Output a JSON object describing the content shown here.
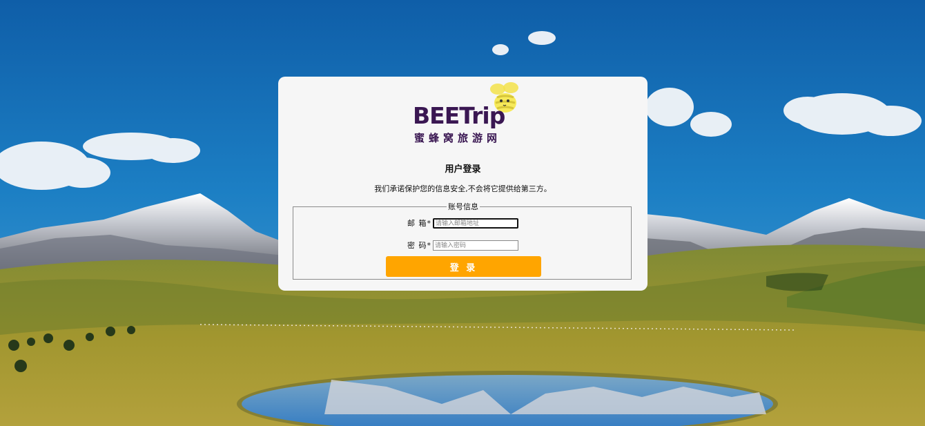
{
  "brand": {
    "name": "BEETrip",
    "tagline": "蜜蜂窝旅游网"
  },
  "login": {
    "title": "用户登录",
    "subtitle": "我们承诺保护您的信息安全,不会将它提供给第三方。",
    "fieldset_legend": "账号信息",
    "email": {
      "label": "邮 箱*",
      "placeholder": "请输入邮箱地址",
      "value": ""
    },
    "password": {
      "label": "密 码*",
      "placeholder": "请输入密码",
      "value": ""
    },
    "submit_label": "登 录"
  },
  "colors": {
    "accent": "#ffa500",
    "brand_purple": "#3a1752",
    "bee_yellow": "#f3e24a",
    "card_bg": "#f6f6f6",
    "sky": "#1a73b8"
  },
  "icons": {
    "logo_mascot": "bee-icon"
  }
}
